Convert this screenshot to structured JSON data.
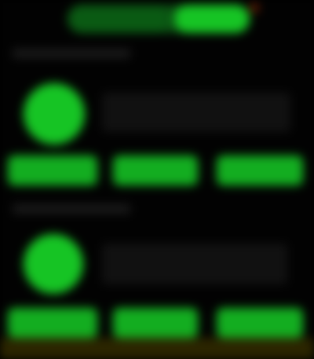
{
  "colors": {
    "accent": "#16c424",
    "accent_dim": "#0a5a13",
    "background": "#020202",
    "bottom_strip": "#2b2500",
    "notification_dot": "#6a1f04"
  },
  "header": {
    "segmented_control": {
      "options": [
        "",
        ""
      ],
      "selected_index": 1
    }
  },
  "sections": [
    {
      "label": "",
      "avatar_icon": "avatar-circle",
      "text": "",
      "buttons": [
        "",
        "",
        ""
      ]
    },
    {
      "label": "",
      "avatar_icon": "avatar-circle",
      "text": "",
      "buttons": [
        "",
        "",
        ""
      ]
    }
  ]
}
